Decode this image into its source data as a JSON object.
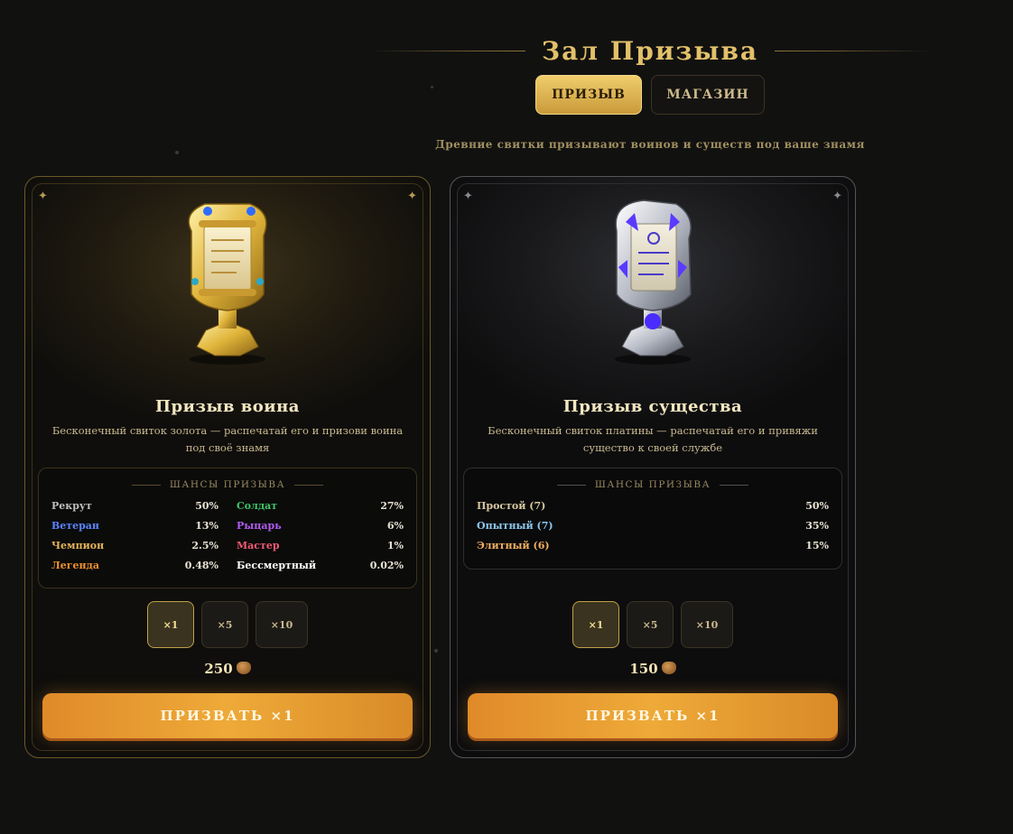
{
  "header": {
    "title": "Зал Призыва",
    "tabs": [
      {
        "label": "ПРИЗЫВ",
        "active": true
      },
      {
        "label": "МАГАЗИН",
        "active": false
      }
    ],
    "subtitle": "Древние свитки призывают воинов и существ под ваше знамя"
  },
  "cards": [
    {
      "title": "Призыв воина",
      "description": "Бесконечный свиток золота — распечатай его и призови воина под своё знамя",
      "odds_title": "ШАНСЫ ПРИЗЫВА",
      "odds": [
        {
          "name": "Рекрут",
          "pct": "50%",
          "color": "#bfbfbf"
        },
        {
          "name": "Солдат",
          "pct": "27%",
          "color": "#3fc46a"
        },
        {
          "name": "Ветеран",
          "pct": "13%",
          "color": "#5a84ff"
        },
        {
          "name": "Рыцарь",
          "pct": "6%",
          "color": "#b25bf0"
        },
        {
          "name": "Чемпион",
          "pct": "2.5%",
          "color": "#e5b45a"
        },
        {
          "name": "Мастер",
          "pct": "1%",
          "color": "#f05a72"
        },
        {
          "name": "Легенда",
          "pct": "0.48%",
          "color": "#f0922e"
        },
        {
          "name": "Бессмертный",
          "pct": "0.02%",
          "color": "#ffffff"
        }
      ],
      "qty_options": [
        "×1",
        "×5",
        "×10"
      ],
      "selected_qty": "×1",
      "price": "250",
      "summon_label": "ПРИЗВАТЬ ×1",
      "scroll_icon": "golden-scroll-icon"
    },
    {
      "title": "Призыв существа",
      "description": "Бесконечный свиток платины — распечатай его и привяжи существо к своей службе",
      "odds_title": "ШАНСЫ ПРИЗЫВА",
      "odds": [
        {
          "name": "Простой (7)",
          "pct": "50%",
          "color": "#d9c9a0"
        },
        {
          "name": "Опытный (7)",
          "pct": "35%",
          "color": "#8fc8f0"
        },
        {
          "name": "Элитный (6)",
          "pct": "15%",
          "color": "#f0b060"
        }
      ],
      "qty_options": [
        "×1",
        "×5",
        "×10"
      ],
      "selected_qty": "×1",
      "price": "150",
      "summon_label": "ПРИЗВАТЬ ×1",
      "scroll_icon": "platinum-scroll-icon"
    }
  ]
}
